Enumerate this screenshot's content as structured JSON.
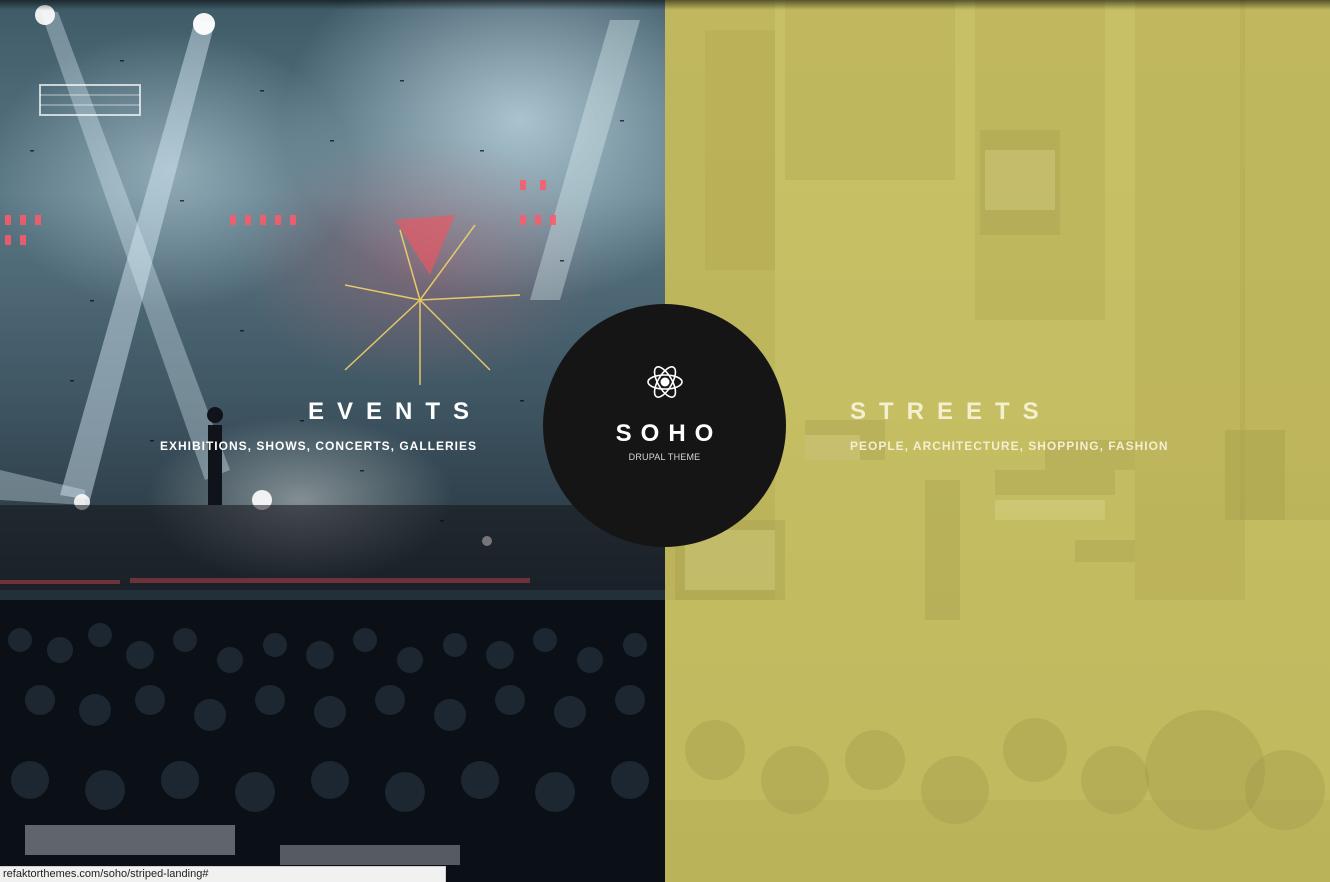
{
  "logo": {
    "name": "SOHO",
    "tagline": "DRUPAL THEME",
    "icon": "atom-flower-icon"
  },
  "panels": [
    {
      "title": "EVENTS",
      "subtitle": "EXHIBITIONS, SHOWS, CONCERTS, GALLERIES"
    },
    {
      "title": "STREETS",
      "subtitle": "PEOPLE, ARCHITECTURE, SHOPPING, FASHION",
      "tint": "#c8c167"
    }
  ],
  "status_bar": {
    "url": "refaktorthemes.com/soho/striped-landing#"
  }
}
